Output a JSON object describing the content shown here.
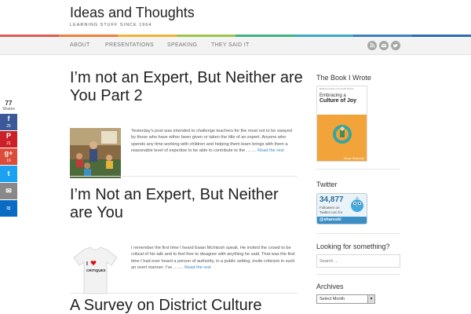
{
  "site": {
    "title": "Ideas and Thoughts",
    "tagline": "LEARNING STUFF SINCE 1964"
  },
  "rainbow_colors": [
    "#e05a4f",
    "#ef7d3c",
    "#f2b234",
    "#9cc44a",
    "#3fb37f",
    "#3aa9c8",
    "#3b7fc4",
    "#2f6bb3"
  ],
  "nav": {
    "items": [
      "ABOUT",
      "PRESENTATIONS",
      "SPEAKING",
      "THEY SAID IT"
    ],
    "social_icons": [
      "rss-icon",
      "email-icon",
      "twitter-icon"
    ]
  },
  "share": {
    "count": "77",
    "label": "Shares",
    "buttons": [
      {
        "icon": "facebook-icon",
        "glyph": "f",
        "count": "25",
        "color": "#3b5998"
      },
      {
        "icon": "pinterest-icon",
        "glyph": "P",
        "count": "21",
        "color": "#cb2027"
      },
      {
        "icon": "googleplus-icon",
        "glyph": "g+",
        "count": "16",
        "color": "#dd4b39"
      },
      {
        "icon": "twitter-icon",
        "glyph": "t",
        "count": "",
        "color": "#1da1f2"
      },
      {
        "icon": "email-icon",
        "glyph": "✉",
        "count": "",
        "color": "#888888"
      },
      {
        "icon": "sumome-icon",
        "glyph": "≈",
        "count": "",
        "color": "#0a6bc4"
      }
    ]
  },
  "posts": [
    {
      "title": "I’m not an Expert, But Neither are You Part 2",
      "excerpt": "Yesterday’s post was intended to challenge teachers for the most not to be swayed by those who have either been given or taken the title of an expert. Anyone who spends any time working with children and helping them learn brings with them a reasonable level of expertise to be able to contribute to the …….",
      "read_more": "Read the rest"
    },
    {
      "title": "I’m Not an Expert, But Neither are You",
      "excerpt": "I remember the first time I heard Ewan McIntosh speak. He invited the crowd to be critical of his talk and to feel free to disagree with anything he said. That was the first time I had ever heard a person of authority, in a public setting, invite criticism in such an overt manner. I’ve …….",
      "read_more": "Read the rest",
      "thumb_text": "I ♥ CRITIQUES"
    },
    {
      "title": "A Survey on District Culture"
    }
  ],
  "sidebar": {
    "book": {
      "title": "The Book I Wrote",
      "cover_small": "Building a Culture of Trust with Schools",
      "cover_title_1": "Embracing a",
      "cover_title_2": "Culture of Joy",
      "author": "Dean Shareski"
    },
    "twitter": {
      "title": "Twitter",
      "followers": "34,877",
      "line1": "Followers on",
      "line2": "Twitter.com for",
      "handle": "@shareski"
    },
    "search": {
      "title": "Looking for something?",
      "placeholder": "Search ..."
    },
    "archives": {
      "title": "Archives",
      "selected": "Select Month"
    }
  }
}
